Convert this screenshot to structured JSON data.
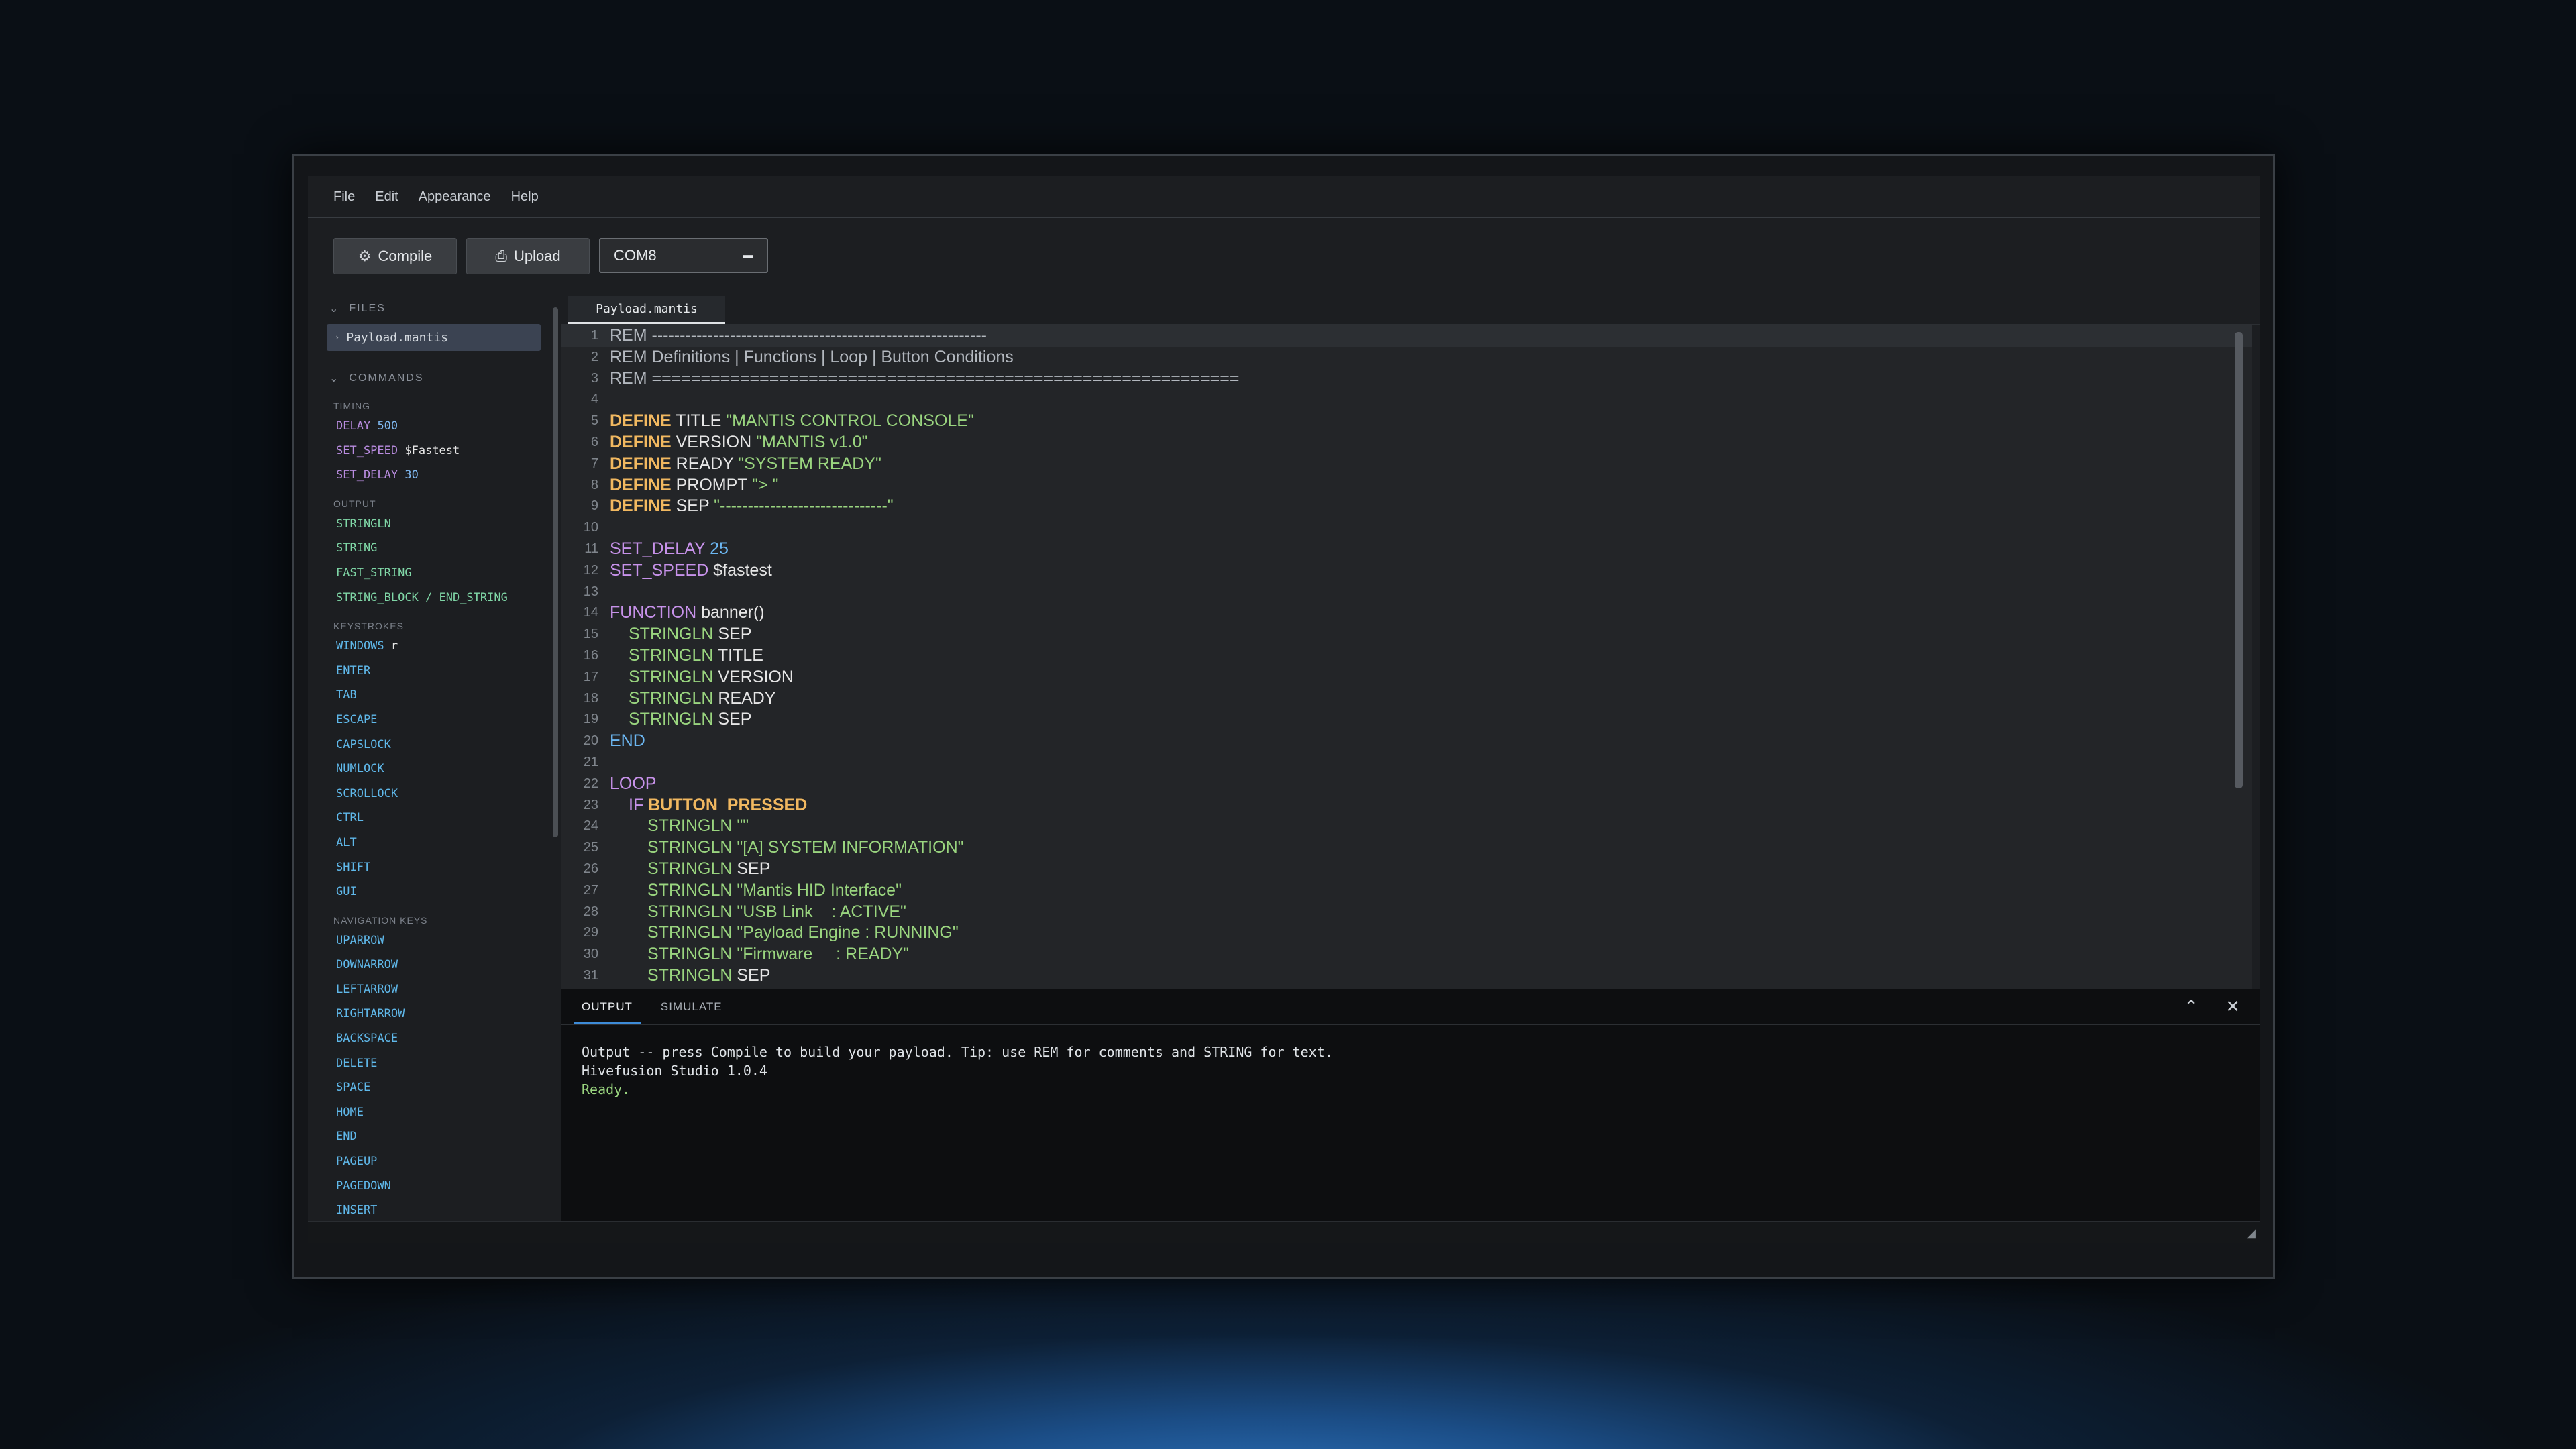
{
  "menu": [
    "File",
    "Edit",
    "Appearance",
    "Help"
  ],
  "toolbar": {
    "compile_label": "Compile",
    "upload_label": "Upload",
    "port_value": "COM8"
  },
  "sidebar": {
    "files_header": "FILES",
    "active_file": "Payload.mantis",
    "commands_header": "COMMANDS",
    "groups": [
      {
        "title": "TIMING",
        "items": [
          {
            "name": "DELAY",
            "arg": "500"
          },
          {
            "name": "SET_SPEED",
            "arg": "$Fastest"
          },
          {
            "name": "SET_DELAY",
            "arg": "30"
          }
        ]
      },
      {
        "title": "OUTPUT",
        "items": [
          "STRINGLN",
          "STRING",
          "FAST_STRING",
          "STRING_BLOCK / END_STRING"
        ]
      },
      {
        "title": "KEYSTROKES",
        "items": [
          {
            "name": "WINDOWS",
            "arg": "r"
          },
          "ENTER",
          "TAB",
          "ESCAPE",
          "CAPSLOCK",
          "NUMLOCK",
          "SCROLLOCK",
          "CTRL",
          "ALT",
          "SHIFT",
          "GUI"
        ]
      },
      {
        "title": "NAVIGATION KEYS",
        "items": [
          "UPARROW",
          "DOWNARROW",
          "LEFTARROW",
          "RIGHTARROW",
          "BACKSPACE",
          "DELETE",
          "SPACE",
          "HOME",
          "END",
          "PAGEUP",
          "PAGEDOWN",
          "INSERT"
        ]
      }
    ]
  },
  "editor": {
    "tab": "Payload.mantis",
    "lines": [
      "REM ------------------------------------------------------------",
      "REM Definitions | Functions | Loop | Button Conditions",
      "REM ============================================================",
      "",
      "DEFINE TITLE \"MANTIS CONTROL CONSOLE\"",
      "DEFINE VERSION \"MANTIS v1.0\"",
      "DEFINE READY \"SYSTEM READY\"",
      "DEFINE PROMPT \"> \"",
      "DEFINE SEP \"------------------------------\"",
      "",
      "SET_DELAY 25",
      "SET_SPEED $fastest",
      "",
      "FUNCTION banner()",
      "STRINGLN SEP",
      "STRINGLN TITLE",
      "STRINGLN VERSION",
      "STRINGLN READY",
      "STRINGLN SEP",
      "END",
      "",
      "LOOP",
      "IF BUTTON_PRESSED",
      "STRINGLN \"\"",
      "STRINGLN \"[A] SYSTEM INFORMATION\"",
      "STRINGLN SEP",
      "STRINGLN \"Mantis HID Interface\"",
      "STRINGLN \"USB Link    : ACTIVE\"",
      "STRINGLN \"Payload Engine : RUNNING\"",
      "STRINGLN \"Firmware     : READY\"",
      "STRINGLN SEP"
    ]
  },
  "panel": {
    "tabs": [
      "OUTPUT",
      "SIMULATE"
    ],
    "output_lines": [
      "Output -- press Compile to build your payload. Tip: use REM for comments and STRING for text.",
      "Hivefusion Studio 1.0.4"
    ],
    "ready": "Ready."
  }
}
